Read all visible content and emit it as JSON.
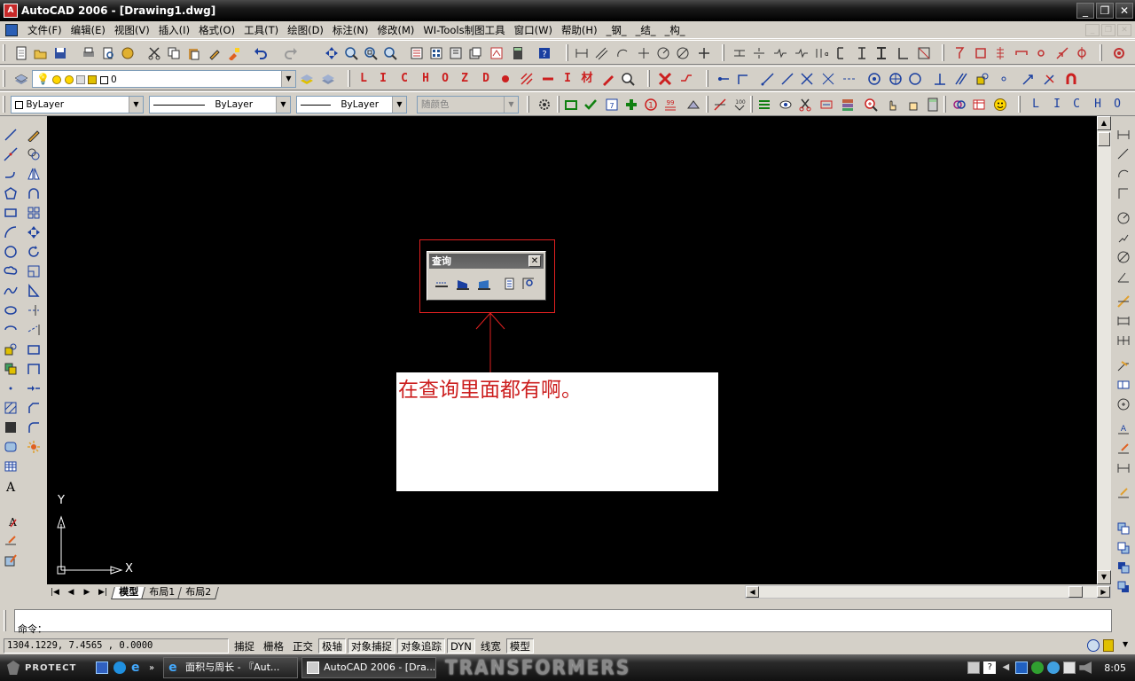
{
  "window": {
    "title": "AutoCAD 2006 - [Drawing1.dwg]"
  },
  "menu": [
    "文件(F)",
    "编辑(E)",
    "视图(V)",
    "插入(I)",
    "格式(O)",
    "工具(T)",
    "绘图(D)",
    "标注(N)",
    "修改(M)",
    "WI-Tools制图工具",
    "窗口(W)",
    "帮助(H)",
    "_钢_",
    "_结_",
    "_构_"
  ],
  "layer": {
    "current": "0"
  },
  "properties": {
    "color": "ByLayer",
    "linetype": "ByLayer",
    "lineweight": "ByLayer",
    "plotstyle": "随颜色"
  },
  "red_letters": [
    "L",
    "I",
    "C",
    "H",
    "O",
    "Z",
    "D",
    "I",
    "材"
  ],
  "right_letters": [
    "L",
    "I",
    "C",
    "H",
    "O"
  ],
  "query_panel": {
    "title": "查询"
  },
  "annotation": {
    "text": "在查询里面都有啊。"
  },
  "ucs": {
    "x_label": "X",
    "y_label": "Y"
  },
  "layout_tabs": [
    "模型",
    "布局1",
    "布局2"
  ],
  "command": {
    "prompt": "命令："
  },
  "status": {
    "coords": "1304.1229, 7.4565 , 0.0000",
    "buttons": [
      {
        "label": "捕捉",
        "on": false
      },
      {
        "label": "栅格",
        "on": false
      },
      {
        "label": "正交",
        "on": false
      },
      {
        "label": "极轴",
        "on": true
      },
      {
        "label": "对象捕捉",
        "on": true
      },
      {
        "label": "对象追踪",
        "on": true
      },
      {
        "label": "DYN",
        "on": true
      },
      {
        "label": "线宽",
        "on": false
      },
      {
        "label": "模型",
        "on": true
      }
    ]
  },
  "taskbar": {
    "start": "PROTECT",
    "tasks": [
      "面积与周长 - 『Aut...",
      "AutoCAD 2006 - [Dra..."
    ],
    "brand": "TRANSFORMERS",
    "clock": "8:05"
  },
  "colors": {
    "canvas": "#000000",
    "annotation_red": "#cc1f1f",
    "highlight_red": "#e02020",
    "toolbar_bg": "#d4d0c8"
  }
}
